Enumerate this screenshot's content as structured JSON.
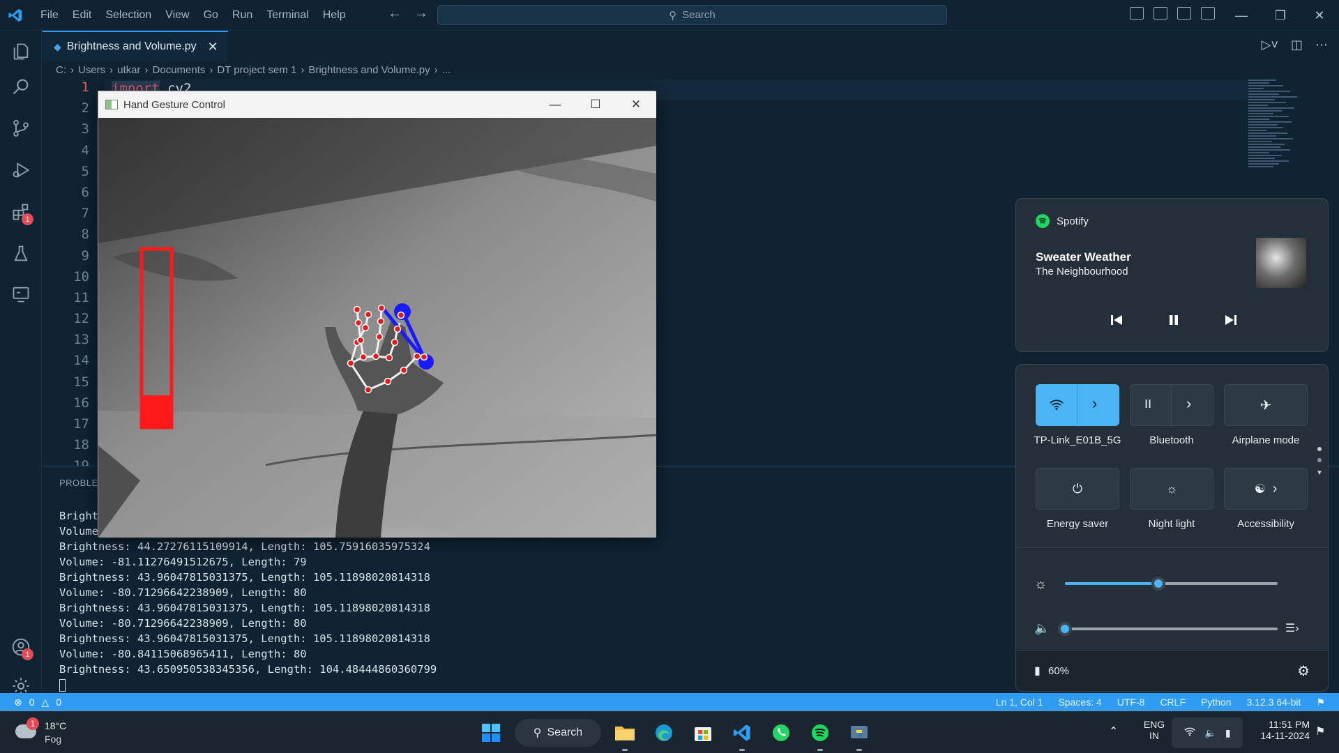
{
  "titlebar": {
    "menu": [
      "File",
      "Edit",
      "Selection",
      "View",
      "Go",
      "Run",
      "Terminal",
      "Help"
    ],
    "search_placeholder": "Search"
  },
  "activity": {
    "extensions_badge": "1",
    "accounts_badge": "1"
  },
  "editor": {
    "tab_label": "Brightness and Volume.py",
    "breadcrumb": [
      "C:",
      "Users",
      "utkar",
      "Documents",
      "DT project sem 1",
      "Brightness and Volume.py",
      "..."
    ],
    "line_numbers": [
      "1",
      "2",
      "3",
      "4",
      "5",
      "6",
      "7",
      "8",
      "9",
      "10",
      "11",
      "12",
      "13",
      "14",
      "15",
      "16",
      "17",
      "18",
      "19"
    ],
    "code_line_1_kw": "import",
    "code_line_1_rest": " cv2"
  },
  "panel": {
    "title": "PROBLEMS",
    "terminal_lines": [
      "Bright",
      "Volume:",
      "Brightness: 44.27276115109914, Length: 105.75916035975324",
      "Volume: -81.11276491512675, Length: 79",
      "Brightness: 43.96047815031375, Length: 105.11898020814318",
      "Volume: -80.71296642238909, Length: 80",
      "Brightness: 43.96047815031375, Length: 105.11898020814318",
      "Volume: -80.71296642238909, Length: 80",
      "Brightness: 43.96047815031375, Length: 105.11898020814318",
      "Volume: -80.84115068965411, Length: 80",
      "Brightness: 43.650950538345356, Length: 104.48444860360799"
    ]
  },
  "statusbar": {
    "errors": "0",
    "warnings": "0",
    "position": "Ln 1, Col 1",
    "spaces": "Spaces: 4",
    "encoding": "UTF-8",
    "eol": "CRLF",
    "language": "Python",
    "interpreter": "3.12.3 64-bit"
  },
  "cv_window": {
    "title": "Hand Gesture Control",
    "bar_level": 0.18
  },
  "media": {
    "app": "Spotify",
    "song": "Sweater Weather",
    "artist": "The Neighbourhood"
  },
  "quick_settings": {
    "tiles": [
      {
        "label": "TP-Link_E01B_5G",
        "icon": "wifi-icon",
        "on": true
      },
      {
        "label": "Bluetooth",
        "icon": "bluetooth-icon",
        "on": false
      },
      {
        "label": "Airplane mode",
        "icon": "airplane-icon",
        "on": false
      },
      {
        "label": "Energy saver",
        "icon": "energy-saver-icon",
        "on": false
      },
      {
        "label": "Night light",
        "icon": "night-light-icon",
        "on": false
      },
      {
        "label": "Accessibility",
        "icon": "accessibility-icon",
        "on": false
      }
    ],
    "brightness_level": 0.44,
    "volume_level": 0.0,
    "battery": "60%"
  },
  "taskbar": {
    "weather_badge": "1",
    "temperature": "18°C",
    "condition": "Fog",
    "search_label": "Search",
    "language": "ENG",
    "region": "IN",
    "time": "11:51 PM",
    "date": "14-11-2024"
  },
  "colors": {
    "accent": "#2f9cf2",
    "qs_accent": "#4bb4f5",
    "bar": "#ff0000",
    "landmark": "#e21b1b",
    "gesture": "#1a1aff"
  }
}
